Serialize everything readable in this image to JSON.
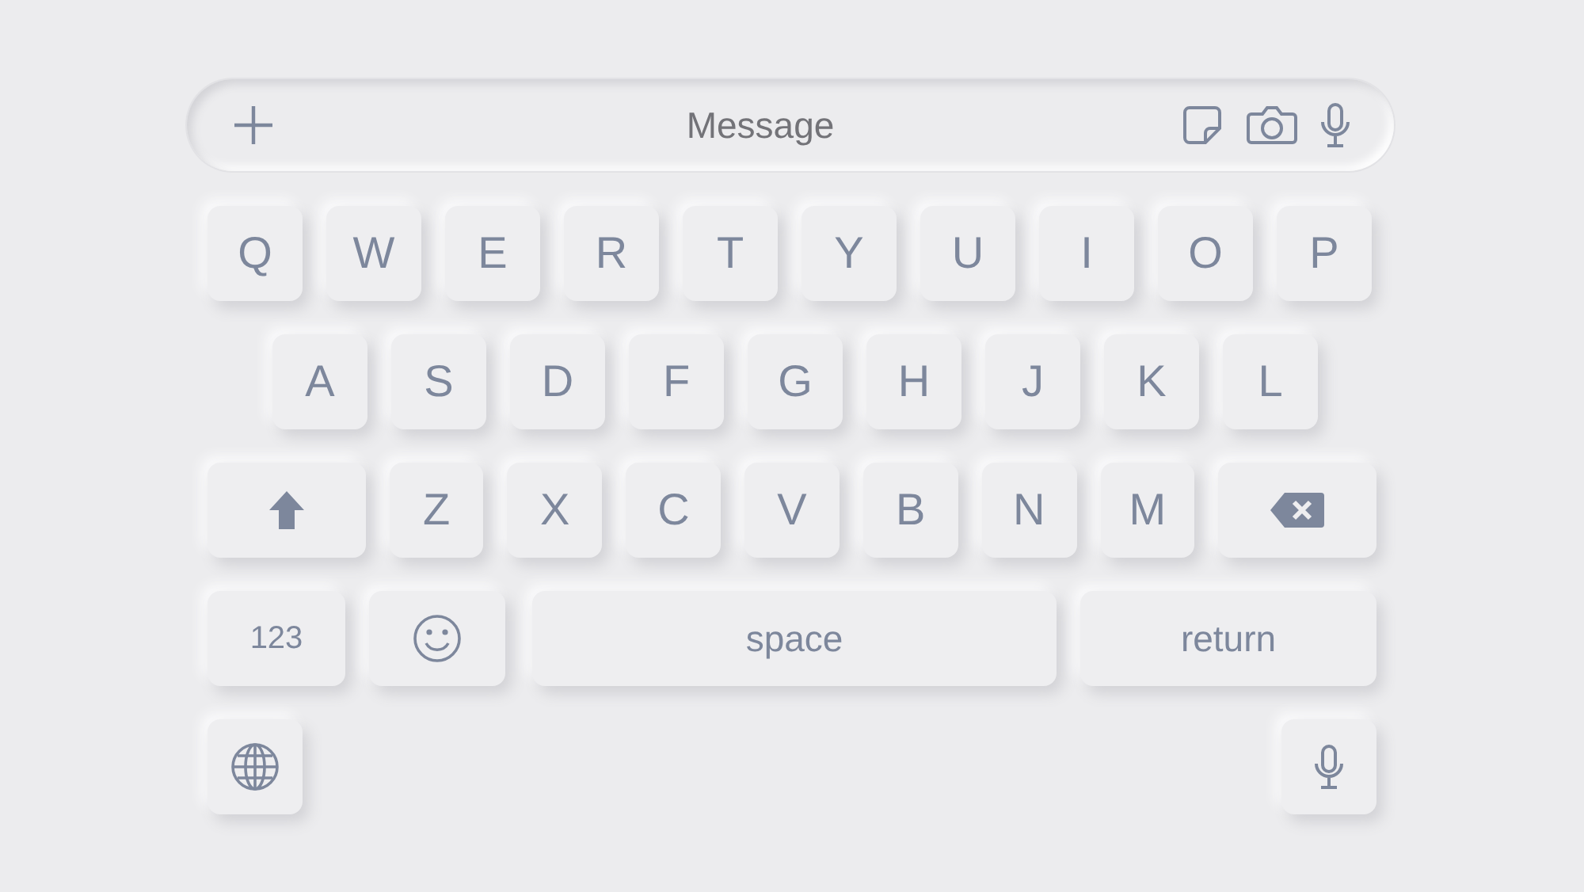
{
  "message_bar": {
    "placeholder": "Message"
  },
  "rows": [
    [
      {
        "kind": "letter",
        "label": "Q"
      },
      {
        "kind": "letter",
        "label": "W"
      },
      {
        "kind": "letter",
        "label": "E"
      },
      {
        "kind": "letter",
        "label": "R"
      },
      {
        "kind": "letter",
        "label": "T"
      },
      {
        "kind": "letter",
        "label": "Y"
      },
      {
        "kind": "letter",
        "label": "U"
      },
      {
        "kind": "letter",
        "label": "I"
      },
      {
        "kind": "letter",
        "label": "O"
      },
      {
        "kind": "letter",
        "label": "P"
      }
    ],
    [
      {
        "kind": "letter",
        "label": "A"
      },
      {
        "kind": "letter",
        "label": "S"
      },
      {
        "kind": "letter",
        "label": "D"
      },
      {
        "kind": "letter",
        "label": "F"
      },
      {
        "kind": "letter",
        "label": "G"
      },
      {
        "kind": "letter",
        "label": "H"
      },
      {
        "kind": "letter",
        "label": "J"
      },
      {
        "kind": "letter",
        "label": "K"
      },
      {
        "kind": "letter",
        "label": "L"
      }
    ],
    [
      {
        "kind": "shift"
      },
      {
        "kind": "letter",
        "label": "Z"
      },
      {
        "kind": "letter",
        "label": "X"
      },
      {
        "kind": "letter",
        "label": "C"
      },
      {
        "kind": "letter",
        "label": "V"
      },
      {
        "kind": "letter",
        "label": "B"
      },
      {
        "kind": "letter",
        "label": "N"
      },
      {
        "kind": "letter",
        "label": "M"
      },
      {
        "kind": "backspace"
      }
    ],
    [
      {
        "kind": "numbers",
        "label": "123"
      },
      {
        "kind": "emoji"
      },
      {
        "kind": "space",
        "label": "space"
      },
      {
        "kind": "return",
        "label": "return"
      }
    ],
    [
      {
        "kind": "globe"
      },
      {
        "kind": "mic"
      }
    ]
  ]
}
